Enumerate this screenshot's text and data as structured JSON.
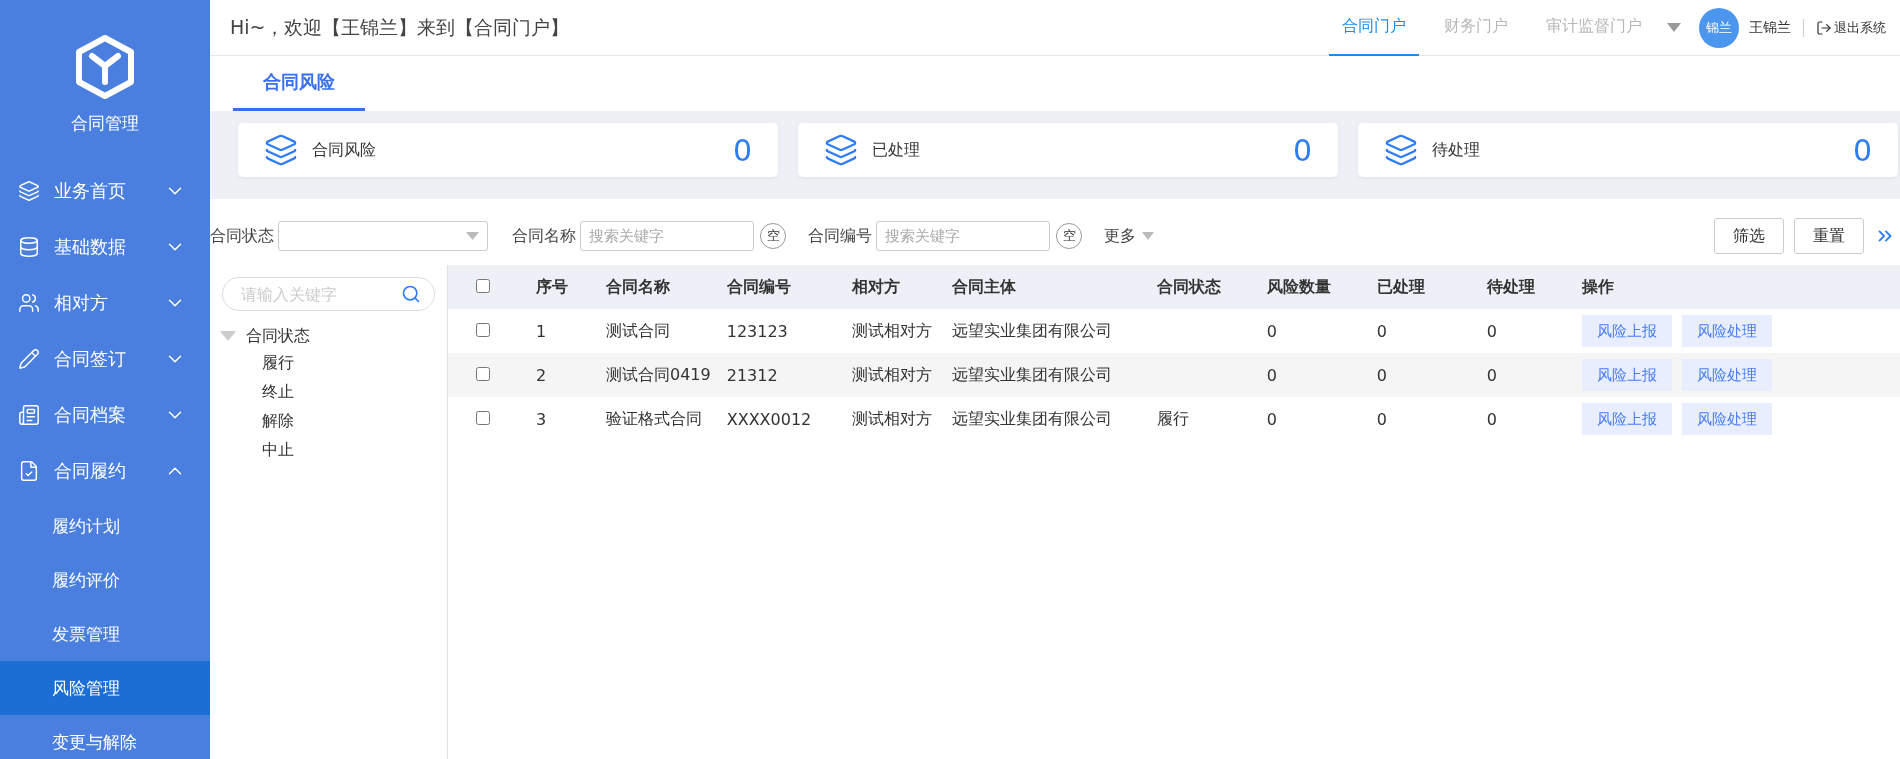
{
  "brand": {
    "title": "合同管理"
  },
  "sidebar": {
    "items": [
      {
        "label": "业务首页",
        "expanded": false
      },
      {
        "label": "基础数据",
        "expanded": false
      },
      {
        "label": "相对方",
        "expanded": false
      },
      {
        "label": "合同签订",
        "expanded": false
      },
      {
        "label": "合同档案",
        "expanded": false
      },
      {
        "label": "合同履约",
        "expanded": true,
        "children": [
          {
            "label": "履约计划",
            "selected": false
          },
          {
            "label": "履约评价",
            "selected": false
          },
          {
            "label": "发票管理",
            "selected": false
          },
          {
            "label": "风险管理",
            "selected": true
          },
          {
            "label": "变更与解除",
            "selected": false
          }
        ]
      }
    ]
  },
  "header": {
    "greeting": "Hi~，欢迎【王锦兰】来到【合同门户】",
    "portals": [
      {
        "label": "合同门户",
        "selected": true
      },
      {
        "label": "财务门户",
        "selected": false
      },
      {
        "label": "审计监督门户",
        "selected": false
      }
    ],
    "avatar": "锦兰",
    "user": "王锦兰",
    "logout": "退出系统"
  },
  "tabs": [
    {
      "label": "合同风险",
      "selected": true
    }
  ],
  "stats": [
    {
      "label": "合同风险",
      "value": "0"
    },
    {
      "label": "已处理",
      "value": "0"
    },
    {
      "label": "待处理",
      "value": "0"
    }
  ],
  "filters": [
    {
      "kind": "select",
      "label": "合同状态"
    },
    {
      "kind": "text",
      "label": "合同名称",
      "placeholder": "搜索关键字",
      "clear": "空"
    },
    {
      "kind": "text",
      "label": "合同编号",
      "placeholder": "搜索关键字",
      "clear": "空"
    }
  ],
  "more": "更多",
  "buttons": [
    "筛选",
    "重置"
  ],
  "tree": {
    "placeholder": "请输入关键字",
    "root": {
      "label": "合同状态",
      "expanded": true,
      "children": [
        {
          "label": "履行"
        },
        {
          "label": "终止"
        },
        {
          "label": "解除"
        },
        {
          "label": "中止"
        }
      ]
    }
  },
  "table": {
    "header_checked": false,
    "columns": [
      "序号",
      "合同名称",
      "合同编号",
      "相对方",
      "合同主体",
      "合同状态",
      "风险数量",
      "已处理",
      "待处理",
      "操作"
    ],
    "rows": [
      {
        "checked": false,
        "cells": [
          "1",
          "测试合同",
          "123123",
          "测试相对方",
          "远望实业集团有限公司",
          "",
          "0",
          "0",
          "0"
        ],
        "actions": [
          "风险上报",
          "风险处理"
        ]
      },
      {
        "checked": false,
        "cells": [
          "2",
          "测试合同0419",
          "21312",
          "测试相对方",
          "远望实业集团有限公司",
          "",
          "0",
          "0",
          "0"
        ],
        "actions": [
          "风险上报",
          "风险处理"
        ]
      },
      {
        "checked": false,
        "cells": [
          "3",
          "验证格式合同",
          "XXXX0012",
          "测试相对方",
          "远望实业集团有限公司",
          "履行",
          "0",
          "0",
          "0"
        ],
        "actions": [
          "风险上报",
          "风险处理"
        ]
      }
    ]
  }
}
